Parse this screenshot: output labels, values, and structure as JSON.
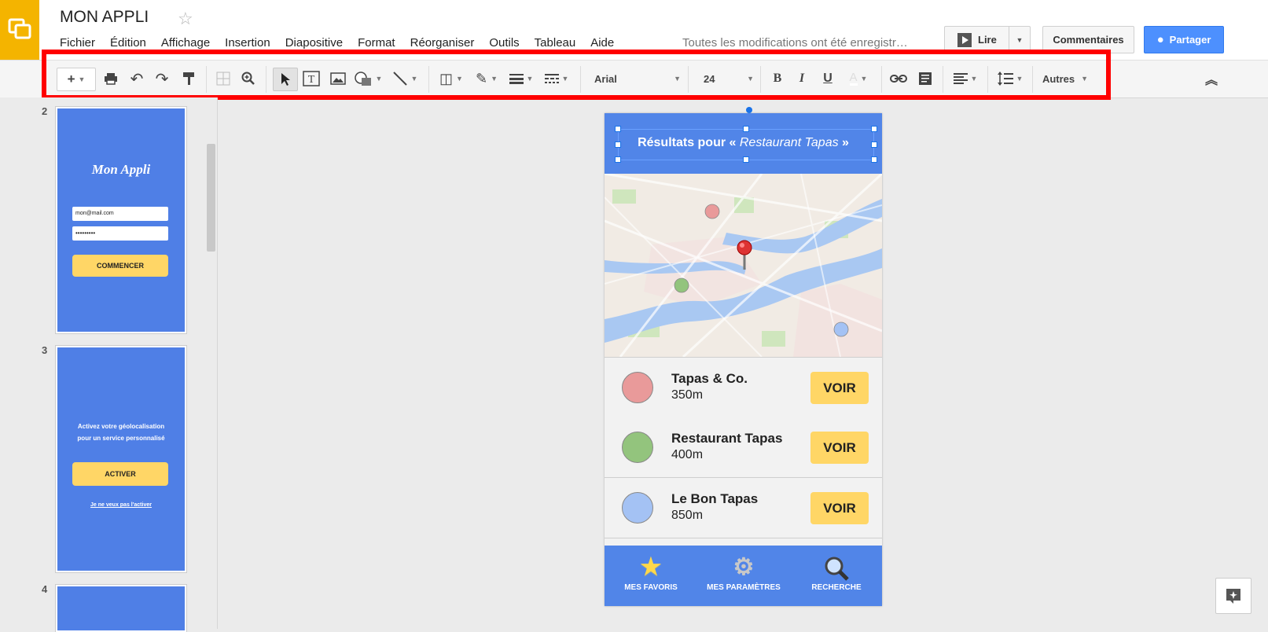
{
  "app": {
    "title": "MON APPLI",
    "menu": [
      "Fichier",
      "Édition",
      "Affichage",
      "Insertion",
      "Diapositive",
      "Format",
      "Réorganiser",
      "Outils",
      "Tableau",
      "Aide"
    ],
    "save_status": "Toutes les modifications ont été enregistr…",
    "present_label": "Lire",
    "comments_label": "Commentaires",
    "share_label": "Partager"
  },
  "toolbar": {
    "font": "Arial",
    "font_size": "24",
    "bold": "B",
    "italic": "I",
    "underline": "U",
    "more": "Autres"
  },
  "filmstrip": {
    "slides": [
      {
        "number": "2",
        "app_name": "Mon Appli",
        "email": "mon@mail.com",
        "password": "•••••••••",
        "button": "COMMENCER"
      },
      {
        "number": "3",
        "text_line1": "Activez votre géolocalisation",
        "text_line2": "pour un service personnalisé",
        "button": "ACTIVER",
        "link": "Je ne veux pas l'activer"
      },
      {
        "number": "4"
      }
    ]
  },
  "slide": {
    "header_prefix": "Résultats pour « ",
    "header_query": "Restaurant Tapas",
    "header_suffix": " »",
    "results": [
      {
        "name": "Tapas & Co.",
        "distance": "350m",
        "button": "VOIR",
        "color": "#e99a9a"
      },
      {
        "name": "Restaurant Tapas",
        "distance": "400m",
        "button": "VOIR",
        "color": "#93c47d"
      },
      {
        "name": "Le Bon Tapas",
        "distance": "850m",
        "button": "VOIR",
        "color": "#a4c2f4"
      }
    ],
    "nav": [
      {
        "label": "MES FAVORIS",
        "icon": "star-icon"
      },
      {
        "label": "MES PARAMÈTRES",
        "icon": "gear-icon"
      },
      {
        "label": "RECHERCHE",
        "icon": "magnifier-icon"
      }
    ]
  },
  "colors": {
    "accent_blue": "#5185e8",
    "button_yellow": "#ffd666",
    "logo_yellow": "#f4b400",
    "highlight_red": "#ff0000",
    "share_blue": "#4d90fe"
  }
}
